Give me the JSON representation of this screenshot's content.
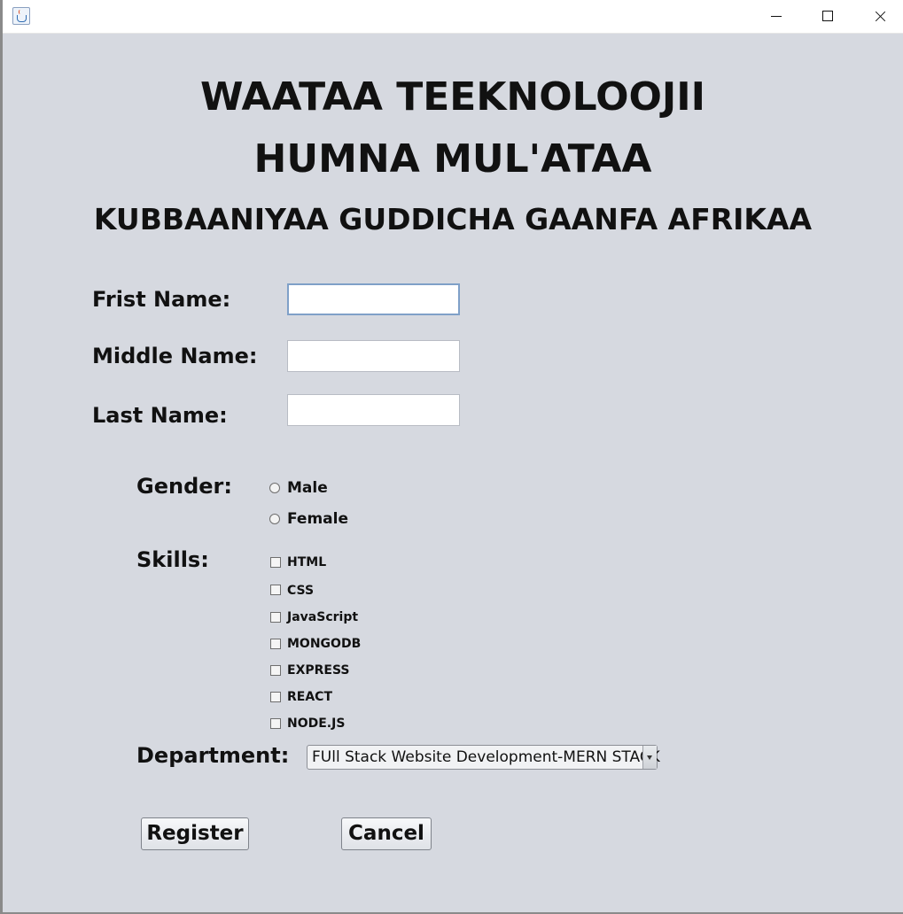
{
  "window": {
    "title": "",
    "controls": {
      "minimize_icon": "minimize-icon",
      "maximize_icon": "maximize-icon",
      "close_icon": "close-icon"
    }
  },
  "header": {
    "line1": "WAATAA TEEKNOLOOJII",
    "line2": "HUMNA MUL'ATAA",
    "line3": "KUBBAANIYAA GUDDICHA GAANFA AFRIKAA"
  },
  "form": {
    "first_name_label": "Frist Name:",
    "middle_name_label": "Middle Name:",
    "last_name_label": "Last Name:",
    "first_name_value": "",
    "middle_name_value": "",
    "last_name_value": "",
    "gender_label": "Gender:",
    "gender_options": [
      "Male",
      "Female"
    ],
    "skills_label": "Skills:",
    "skills": [
      "HTML",
      "CSS",
      "JavaScript",
      "MONGODB",
      "EXPRESS",
      "REACT",
      "NODE.JS"
    ],
    "department_label": "Department:",
    "department_selected": "FUll Stack Website Development-MERN STACK",
    "register_label": "Register",
    "cancel_label": "Cancel"
  },
  "colors": {
    "background": "#d6d9e0",
    "titlebar": "#ffffff",
    "field_focus_border": "#7fa0c8"
  }
}
